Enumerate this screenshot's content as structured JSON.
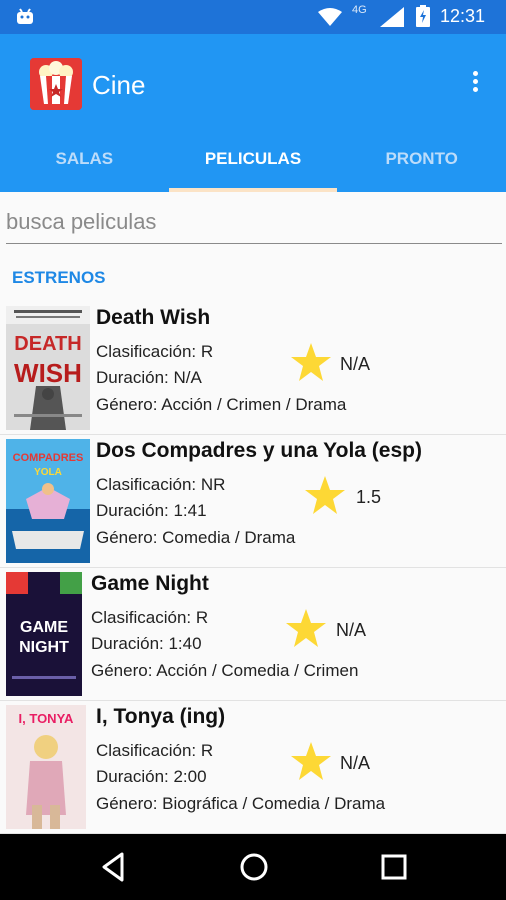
{
  "status_bar": {
    "network": "4G",
    "time": "12:31"
  },
  "app": {
    "title": "Cine"
  },
  "tabs": [
    {
      "label": "SALAS"
    },
    {
      "label": "PELICULAS"
    },
    {
      "label": "PRONTO"
    }
  ],
  "search": {
    "placeholder": "busca peliculas"
  },
  "section": {
    "title": "ESTRENOS"
  },
  "movies": [
    {
      "title": "Death Wish",
      "classification": "Clasificación: R",
      "duration": "Duración: N/A",
      "genre": "Género: Acción / Crimen / Drama",
      "rating": "N/A",
      "poster_text": "DEATH WISH"
    },
    {
      "title": "Dos Compadres y una Yola (esp)",
      "classification": "Clasificación: NR",
      "duration": "Duración: 1:41",
      "genre": "Género: Comedia / Drama",
      "rating": "1.5",
      "poster_text": ""
    },
    {
      "title": "Game Night",
      "classification": "Clasificación: R",
      "duration": "Duración: 1:40",
      "genre": "Género: Acción / Comedia / Crimen",
      "rating": "N/A",
      "poster_text": "GAME NIGHT"
    },
    {
      "title": "I, Tonya (ing)",
      "classification": "Clasificación: R",
      "duration": "Duración: 2:00",
      "genre": "Género: Biográfica / Comedia / Drama",
      "rating": "N/A",
      "poster_text": "I, TONYA"
    }
  ],
  "colors": {
    "app_bar": "#2196f3",
    "status_bar": "#1e73d8",
    "section": "#1e88e5",
    "star": "#fdd835",
    "tab_indicator": "#fbe3c6"
  },
  "icons": {
    "status": [
      "android-icon",
      "wifi-icon",
      "signal-icon",
      "battery-icon"
    ],
    "nav": [
      "back-icon",
      "home-icon",
      "recents-icon"
    ]
  }
}
